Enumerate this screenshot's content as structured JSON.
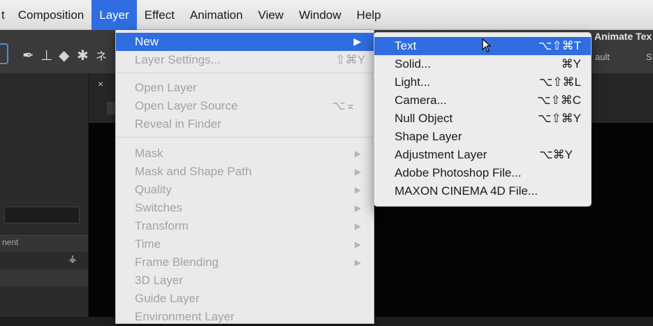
{
  "menubar": {
    "items": [
      {
        "label": "t"
      },
      {
        "label": "Composition"
      },
      {
        "label": "Layer"
      },
      {
        "label": "Effect"
      },
      {
        "label": "Animation"
      },
      {
        "label": "View"
      },
      {
        "label": "Window"
      },
      {
        "label": "Help"
      }
    ],
    "active_index": 2
  },
  "background": {
    "workspace_label": "Animate Tex",
    "workspace_default": "ault",
    "workspace_s": "S",
    "panel_header": "nent"
  },
  "layer_menu": {
    "new_label": "New",
    "layer_settings": {
      "label": "Layer Settings...",
      "shortcut": "⇧⌘Y"
    },
    "open_layer": "Open Layer",
    "open_layer_source": {
      "label": "Open Layer Source",
      "shortcut": "⌥⌅"
    },
    "reveal_in_finder": "Reveal in Finder",
    "mask": "Mask",
    "mask_and_shape_path": "Mask and Shape Path",
    "quality": "Quality",
    "switches": "Switches",
    "transform": "Transform",
    "time": "Time",
    "frame_blending": "Frame Blending",
    "layer_3d": "3D Layer",
    "guide_layer": "Guide Layer",
    "environment_layer": "Environment Layer"
  },
  "new_submenu": {
    "items": [
      {
        "label": "Text",
        "shortcut": "⌥⇧⌘T"
      },
      {
        "label": "Solid...",
        "shortcut": "⌘Y"
      },
      {
        "label": "Light...",
        "shortcut": "⌥⇧⌘L"
      },
      {
        "label": "Camera...",
        "shortcut": "⌥⇧⌘C"
      },
      {
        "label": "Null Object",
        "shortcut": "⌥⇧⌘Y"
      },
      {
        "label": "Shape Layer",
        "shortcut": ""
      },
      {
        "label": "Adjustment Layer",
        "shortcut": "⌥⌘Y"
      },
      {
        "label": "Adobe Photoshop File...",
        "shortcut": ""
      },
      {
        "label": "MAXON CINEMA 4D File...",
        "shortcut": ""
      }
    ],
    "highlighted_index": 0
  },
  "colors": {
    "highlight": "#2f6de0",
    "menu_bg": "#eaeaea",
    "disabled_text": "#a3a3a3"
  }
}
